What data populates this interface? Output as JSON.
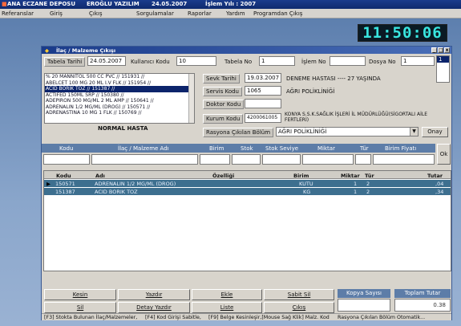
{
  "app": {
    "title_parts": [
      "ANA ECZANE DEPOSU",
      "EROĞLU YAZILIM",
      "24.05.2007",
      "İşlem Yılı : 2007"
    ]
  },
  "menu": [
    "Referanslar",
    "Giriş",
    "Çıkış",
    "Sorgulamalar",
    "Raporlar",
    "Yardım",
    "Programdan Çıkış"
  ],
  "clock": "11:50:06",
  "window": {
    "title": "İlaç / Malzeme Çıkışı",
    "controls": [
      "_",
      "□",
      "x"
    ]
  },
  "form": {
    "tabela_tarihi_label": "Tabela Tarihi",
    "tabela_tarihi": "24.05.2007",
    "kullanici_kodu_label": "Kullanıcı Kodu",
    "kullanici_kodu": "10",
    "tabela_no_label": "Tabela No",
    "tabela_no": "1",
    "islem_no_label": "İşlem No",
    "islem_no": "",
    "dosya_no_label": "Dosya No",
    "dosya_no": "1",
    "dosya_list_value": "1",
    "sevk_tarihi_label": "Sevk Tarihi",
    "sevk_tarihi": "19.03.2007",
    "patient": "DENEME HASTASI ----  27 YAŞINDA",
    "servis_kodu_label": "Servis Kodu",
    "servis_kodu": "1065",
    "servis_adi": "AĞRI POLİKLİNİĞİ",
    "doktor_kodu_label": "Doktor Kodu",
    "kurum_kodu_label": "Kurum Kodu",
    "kurum_kodu": "4200061005",
    "kurum_adi": "KONYA S.S.K.SAĞLIK İŞLERİ İL MÜDÜRLÜĞÜ(SİGORTALI AİLE FERTLERİ)",
    "rasyona_label": "Rasyona Çıkılan Bölüm",
    "rasyona_value": "AĞRI POLİKLİNİĞİ",
    "onay_label": "Onay",
    "normal_hasta": "NORMAL HASTA"
  },
  "drug_list": [
    "% 20 MANNITOL 500 CC PVC   // 151931 //",
    "ABELCET 100 MG 20 ML I.V FLK   // 151954 //",
    "ACID BORIK TOZ   // 151387 //",
    "ACTIFED 150ML SRP   // 150380 //",
    "ADEPIRON 500 MG/ML 2 ML AMP   // 150641 //",
    "ADRENALIN 1/2 MG/ML (DROG)   // 150571 //",
    "ADRENASTINA 10 MG 1 FLK   // 150769 //"
  ],
  "drug_list_selected": 2,
  "entry_header": {
    "kodu": "Kodu",
    "ilac_malzeme_adi": "İlaç / Malzeme Adı",
    "birim": "Birim",
    "stok": "Stok",
    "stok_seviye": "Stok Seviye",
    "miktar": "Miktar",
    "tur": "Tür",
    "birim_fiyati": "Birim Fiyatı",
    "ok_label": "Ok"
  },
  "grid": {
    "columns": [
      "Kodu",
      "Adı",
      "Özelliği",
      "Birim",
      "Miktar",
      "Tür",
      "Tutar"
    ],
    "rows": [
      {
        "kodu": "150571",
        "adi": "ADRENALIN 1/2 MG/ML (DROG)",
        "ozelligi": "",
        "birim": "KUTU",
        "miktar": "1",
        "tur": "2",
        "tutar": ",04"
      },
      {
        "kodu": "151387",
        "adi": "ACID BORIK TOZ",
        "ozelligi": "",
        "birim": "KG",
        "miktar": "1",
        "tur": "2",
        "tutar": ",34"
      }
    ]
  },
  "buttons": {
    "kesin": "Kesin",
    "yazdir": "Yazdır",
    "ekle": "Ekle",
    "sabit_sil": "Sabit Sil",
    "sil": "Sil",
    "detay_yazdir": "Detay Yazdır",
    "liste": "Liste",
    "cikis": "Çıkış"
  },
  "totals": {
    "kopya_sayisi_label": "Kopya Sayısı",
    "kopya_sayisi": "",
    "toplam_tutar_label": "Toplam Tutar",
    "toplam_tutar": "0.38"
  },
  "status": [
    "[F3] Stokta Bulunan İlaç/Malzemeler,",
    "[F4] Kod Girişi Sabitle,",
    "[F9] Belge Kesinleşir,[Mouse Sağ Klik] Malz. Kod",
    "Rasyona Çıkılan Bölüm Otomatik..."
  ],
  "colors": {
    "desktop": "#6f8fb8",
    "titlebar": "#1b3c8c",
    "selection": "#0c246b",
    "grid_row": "#3d6f8f",
    "clock_text": "#39e6e0"
  }
}
